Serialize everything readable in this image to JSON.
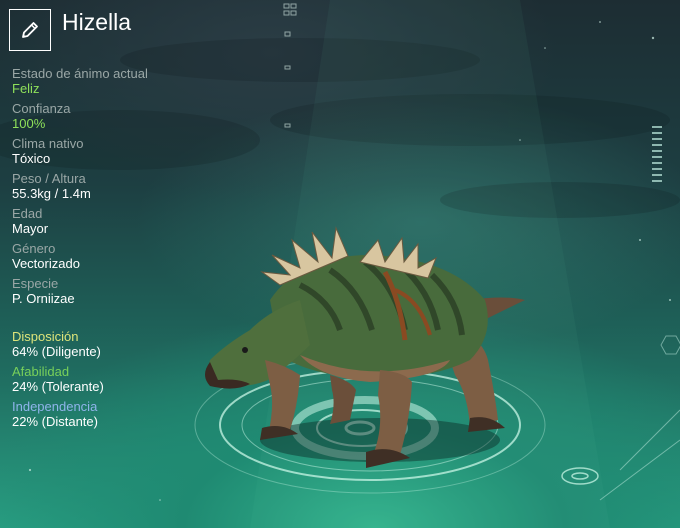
{
  "creature": {
    "name": "Hizella"
  },
  "stats": [
    {
      "label": "Estado de ánimo actual",
      "value": "Feliz",
      "highlight": true
    },
    {
      "label": "Confianza",
      "value": "100%",
      "highlight": true
    },
    {
      "label": "Clima nativo",
      "value": "Tóxico",
      "highlight": false
    },
    {
      "label": "Peso / Altura",
      "value": "55.3kg / 1.4m",
      "highlight": false
    },
    {
      "label": "Edad",
      "value": "Mayor",
      "highlight": false
    },
    {
      "label": "Género",
      "value": "Vectorizado",
      "highlight": false
    },
    {
      "label": "Especie",
      "value": "P. Orniizae",
      "highlight": false
    }
  ],
  "traits": [
    {
      "label": "Disposición",
      "value": "64% (Diligente)",
      "color": "#dde47a"
    },
    {
      "label": "Afabilidad",
      "value": "24% (Tolerante)",
      "color": "#78d05a"
    },
    {
      "label": "Independencia",
      "value": "22% (Distante)",
      "color": "#8fb4ea"
    }
  ],
  "icons": {
    "edit": "pencil-icon"
  },
  "colors": {
    "highlight_value": "#8ee05a",
    "label_gray": "#9aa7a6"
  }
}
